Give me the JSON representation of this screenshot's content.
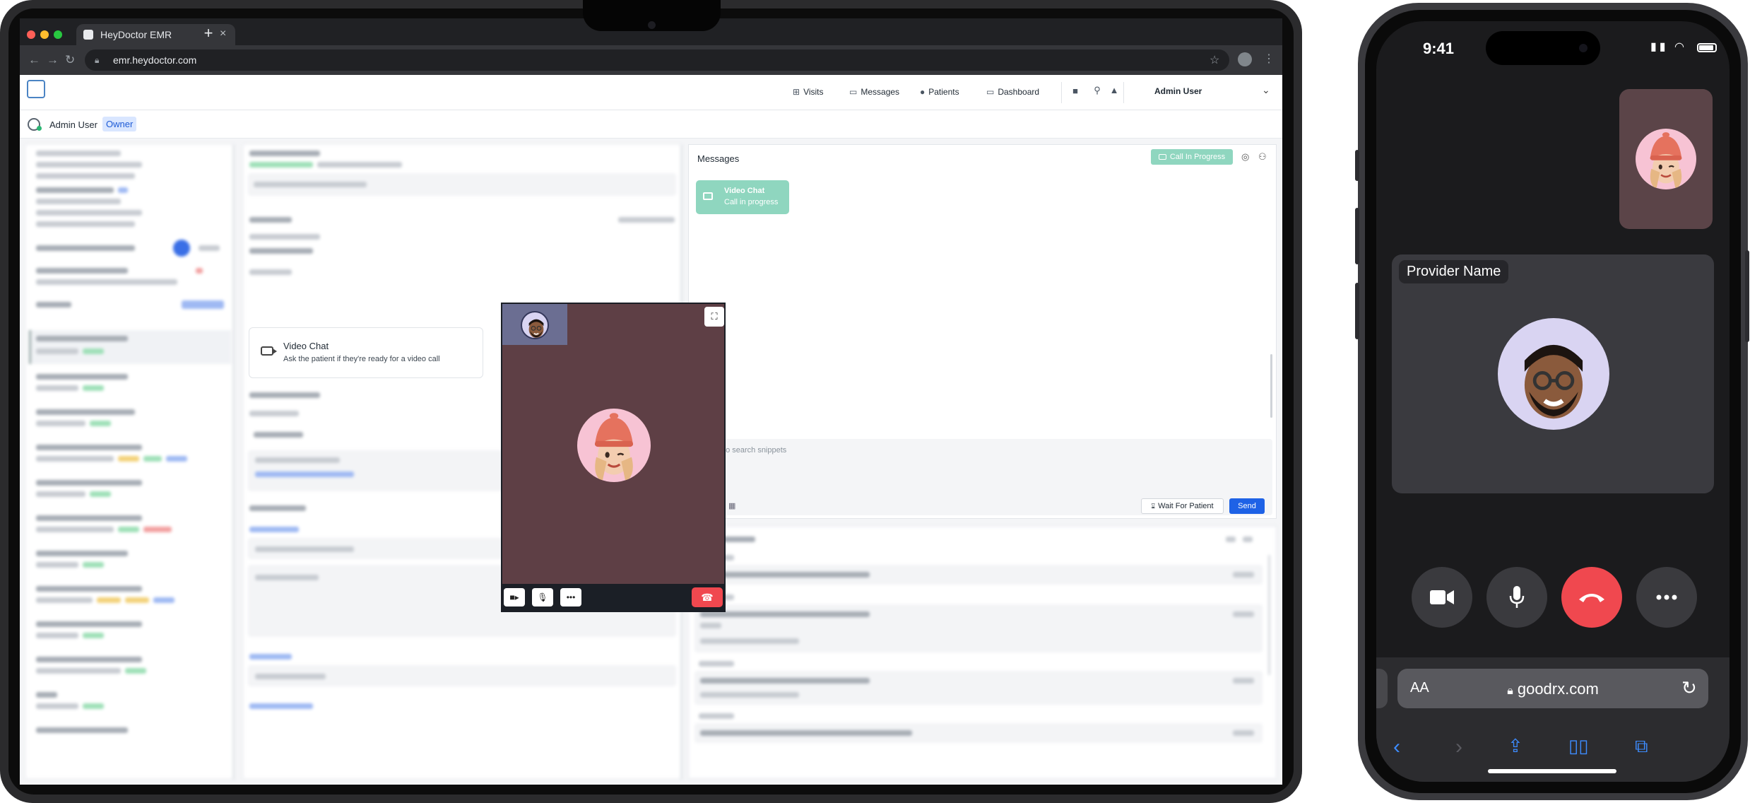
{
  "browser": {
    "tab_title": "HeyDoctor EMR",
    "url": "emr.heydoctor.com",
    "new_tab_label": "+",
    "close_tab_label": "×"
  },
  "nav": {
    "visits": "Visits",
    "messages": "Messages",
    "patients": "Patients",
    "dashboard": "Dashboard",
    "user": "Admin User"
  },
  "subheader": {
    "name": "Admin User",
    "role": "Owner"
  },
  "video_card": {
    "title": "Video Chat",
    "subtitle": "Ask the patient if they're ready for a video call"
  },
  "messages": {
    "title": "Messages",
    "call_badge": "Call In Progress",
    "bubble_title": "Video Chat",
    "bubble_subtitle": "Call in progress",
    "composer_placeholder": "Type . to search snippets",
    "wait_button": "Wait For Patient",
    "send_button": "Send"
  },
  "phone": {
    "time": "9:41",
    "provider_name": "Provider Name",
    "url": "goodrx.com",
    "aa": "AA"
  },
  "colors": {
    "accent_blue": "#1e62e6",
    "call_green": "#8fd6bf",
    "end_call_red": "#f0484f",
    "owner_badge_bg": "#d9e6ff"
  },
  "icons": {
    "visits": "plus-square-icon",
    "messages": "chat-bubble-icon",
    "patients": "person-icon",
    "dashboard": "monitor-icon",
    "camera": "video-camera-icon",
    "mic": "microphone-icon",
    "more": "ellipsis-icon",
    "end": "hang-up-icon"
  }
}
